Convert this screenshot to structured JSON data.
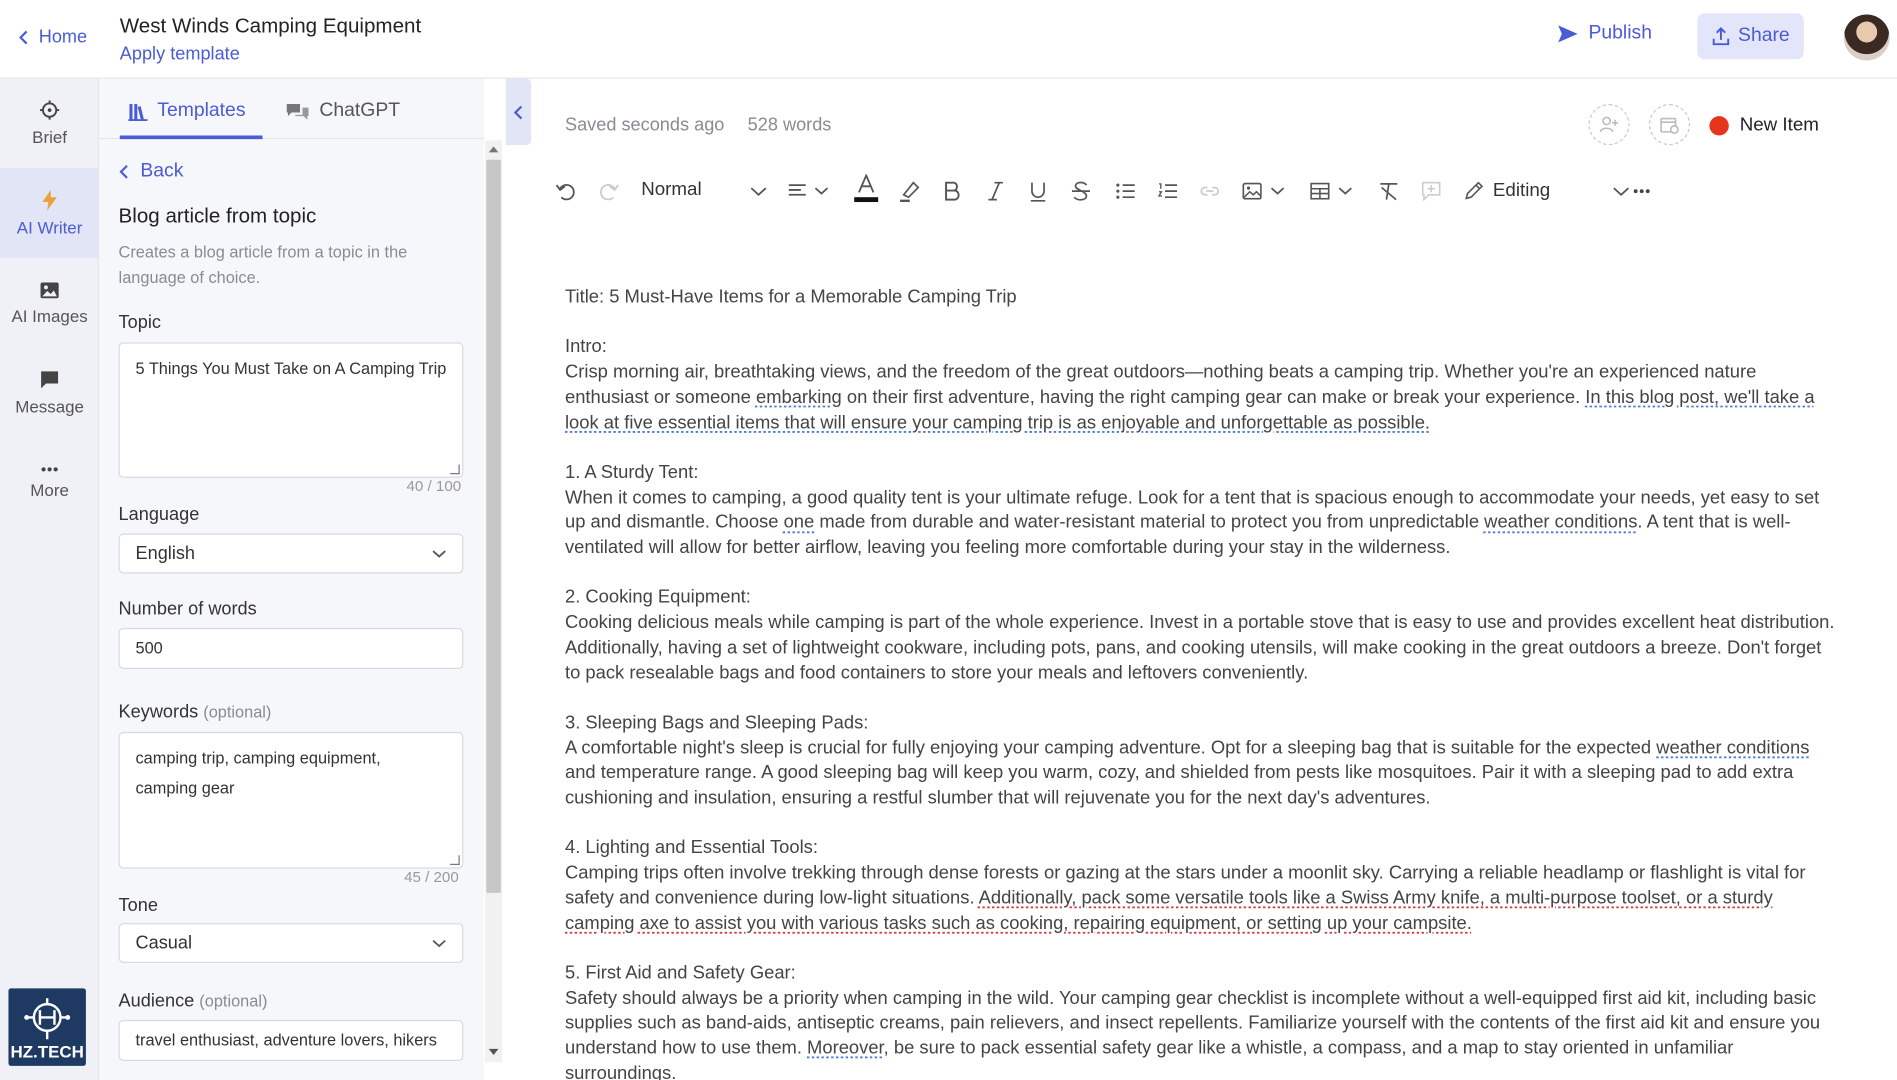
{
  "header": {
    "home_label": "Home",
    "doc_title": "West Winds Camping Equipment",
    "apply_template": "Apply template",
    "publish_label": "Publish",
    "share_label": "Share"
  },
  "nav": {
    "items": [
      {
        "label": "Brief",
        "icon": "crosshair-icon"
      },
      {
        "label": "AI Writer",
        "icon": "lightning-icon"
      },
      {
        "label": "AI Images",
        "icon": "image-icon"
      },
      {
        "label": "Message",
        "icon": "chat-icon"
      },
      {
        "label": "More",
        "icon": "dots-icon"
      }
    ],
    "logo_text": "HZ.TECH"
  },
  "panel": {
    "tabs": [
      "Templates",
      "ChatGPT"
    ],
    "back_label": "Back",
    "title": "Blog article from topic",
    "description": "Creates a blog article from a topic in the language of choice.",
    "topic": {
      "label": "Topic",
      "value": "5 Things You Must Take on A Camping Trip",
      "count": "40 / 100"
    },
    "language": {
      "label": "Language",
      "value": "English"
    },
    "words": {
      "label": "Number of words",
      "value": "500"
    },
    "keywords": {
      "label": "Keywords",
      "optional": "(optional)",
      "value": "camping trip, camping equipment, camping gear",
      "count": "45 / 200"
    },
    "tone": {
      "label": "Tone",
      "value": "Casual"
    },
    "audience": {
      "label": "Audience",
      "optional": "(optional)",
      "value": "travel enthusiast, adventure lovers, hikers"
    }
  },
  "editor": {
    "saved": "Saved seconds ago",
    "word_count": "528 words",
    "new_item": "New Item",
    "status_color": "#e8341c",
    "style_select": "Normal",
    "mode": "Editing",
    "title_line": "Title: 5 Must-Have Items for a Memorable Camping Trip",
    "intro_heading": "Intro:",
    "intro_a": "Crisp morning air, breathtaking views, and the freedom of the great outdoors—nothing beats a camping trip. Whether you're an experienced nature enthusiast or someone ",
    "intro_b": "embarking",
    "intro_c": " on their first adventure, having the right camping gear can make or break your experience. ",
    "intro_d": "In this blog post, we'll take a look at five essential items that will ensure your camping trip is as enjoyable and unforgettable as possible.",
    "s1_heading": "1. A Sturdy Tent:",
    "s1_a": "When it comes to camping, a good quality tent is your ultimate refuge. Look for a tent that is spacious enough to accommodate your needs, yet easy to set up and dismantle. Choose ",
    "s1_b": "one",
    "s1_c": " made from durable and water-resistant material to protect you from unpredictable ",
    "s1_d": "weather conditions",
    "s1_e": ". A tent that is well-ventilated will allow for better airflow, leaving you feeling more comfortable during your stay in the wilderness.",
    "s2_heading": "2. Cooking Equipment:",
    "s2_a": "Cooking delicious meals while camping is part of the whole experience. Invest in a portable stove that is easy to use and provides excellent heat distribution. Additionally, having a set of lightweight cookware, including pots, pans, and cooking utensils, will make cooking in the great outdoors a breeze. Don't forget to pack resealable bags and food containers to store your meals and leftovers conveniently.",
    "s3_heading": "3. Sleeping Bags and Sleeping Pads:",
    "s3_a": "A comfortable night's sleep is crucial for fully enjoying your camping adventure. Opt for a sleeping bag that is suitable for the expected ",
    "s3_b": "weather conditions",
    "s3_c": " and temperature range. A good sleeping bag will keep you warm, cozy, and shielded from pests like mosquitoes. Pair it with a sleeping pad to add extra cushioning and insulation, ensuring a restful slumber that will rejuvenate you for the next day's adventures.",
    "s4_heading": "4. Lighting and Essential Tools:",
    "s4_a": "Camping trips often involve trekking through dense forests or gazing at the stars under a moonlit sky. Carrying a reliable headlamp or flashlight is vital for safety and convenience during low-light situations. ",
    "s4_b": "Additionally, pack some versatile tools like a Swiss Army knife, a multi-purpose toolset, or a sturdy camping axe to assist you with various tasks such as cooking, repairing equipment, or setting up your campsite.",
    "s5_heading": "5. First Aid and Safety Gear:",
    "s5_a": "Safety should always be a priority when camping in the wild. Your camping gear checklist is incomplete without a well-equipped first aid kit, including basic supplies such as band-aids, antiseptic creams, pain relievers, and insect repellents. Familiarize yourself with the contents of the first aid kit and ensure you understand how to use them. ",
    "s5_b": "Moreover",
    "s5_c": ", be sure to pack essential safety gear like a whistle, a compass, and a map to stay oriented in unfamiliar surroundings."
  }
}
